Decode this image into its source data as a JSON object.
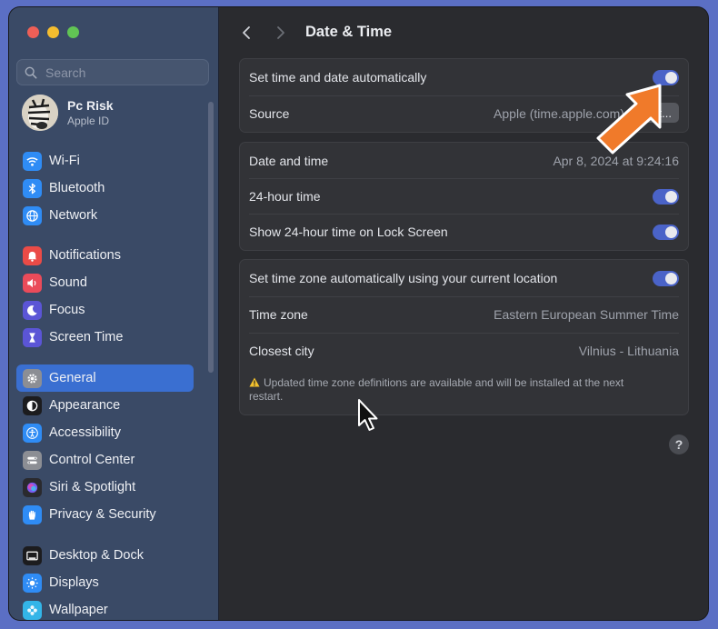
{
  "window": {
    "traffic_lights": [
      "close",
      "minimize",
      "zoom"
    ]
  },
  "sidebar": {
    "search_placeholder": "Search",
    "profile": {
      "name": "Pc Risk",
      "subtitle": "Apple ID"
    },
    "items": [
      {
        "label": "Wi-Fi",
        "icon": "wifi-icon",
        "color": "#2f8cf5"
      },
      {
        "label": "Bluetooth",
        "icon": "bluetooth-icon",
        "color": "#2f8cf5"
      },
      {
        "label": "Network",
        "icon": "globe-icon",
        "color": "#2f8cf5"
      },
      {
        "label": "Notifications",
        "icon": "bell-icon",
        "color": "#ea4b47"
      },
      {
        "label": "Sound",
        "icon": "speaker-icon",
        "color": "#ea4b5a"
      },
      {
        "label": "Focus",
        "icon": "moon-icon",
        "color": "#5b55d6"
      },
      {
        "label": "Screen Time",
        "icon": "hourglass-icon",
        "color": "#5b55d6"
      },
      {
        "label": "General",
        "icon": "gear-icon",
        "color": "#8c8e94",
        "selected": true
      },
      {
        "label": "Appearance",
        "icon": "appearance-icon",
        "color": "#1c1c1e"
      },
      {
        "label": "Accessibility",
        "icon": "accessibility-icon",
        "color": "#2f8cf5"
      },
      {
        "label": "Control Center",
        "icon": "control-center-icon",
        "color": "#8c8e94"
      },
      {
        "label": "Siri & Spotlight",
        "icon": "siri-icon",
        "color": "#2a2a2e"
      },
      {
        "label": "Privacy & Security",
        "icon": "hand-icon",
        "color": "#2f8cf5"
      },
      {
        "label": "Desktop & Dock",
        "icon": "dock-icon",
        "color": "#1c1c1e"
      },
      {
        "label": "Displays",
        "icon": "sun-icon",
        "color": "#2f8cf5"
      },
      {
        "label": "Wallpaper",
        "icon": "wallpaper-icon",
        "color": "#33b5e8"
      }
    ]
  },
  "main": {
    "title": "Date & Time",
    "group1": {
      "auto_label": "Set time and date automatically",
      "auto_on": true,
      "source_label": "Source",
      "source_value": "Apple (time.apple.com)",
      "set_button": "Set..."
    },
    "group2": {
      "datetime_label": "Date and time",
      "datetime_value": "Apr 8, 2024 at 9:24:16",
      "h24_label": "24-hour time",
      "h24_on": true,
      "lock_label": "Show 24-hour time on Lock Screen",
      "lock_on": true
    },
    "group3": {
      "tz_auto_label": "Set time zone automatically using your current location",
      "tz_auto_on": true,
      "tz_label": "Time zone",
      "tz_value": "Eastern European Summer Time",
      "city_label": "Closest city",
      "city_value": "Vilnius - Lithuania",
      "warning": "Updated time zone definitions are available and will be installed at the next restart."
    },
    "help": "?"
  },
  "colors": {
    "accent": "#4a63c8",
    "selection": "#3a6fd1",
    "annotation_arrow": "#f07a2a"
  }
}
